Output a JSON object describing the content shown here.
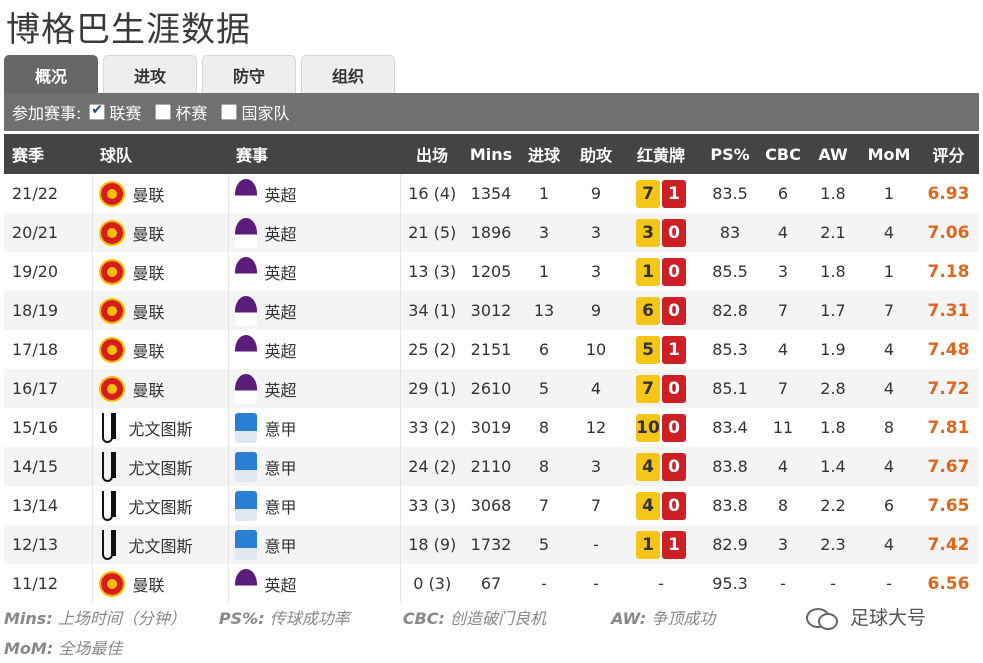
{
  "page_title": "博格巴生涯数据",
  "tabs": [
    {
      "label": "概况",
      "active": true
    },
    {
      "label": "进攻",
      "active": false
    },
    {
      "label": "防守",
      "active": false
    },
    {
      "label": "组织",
      "active": false
    }
  ],
  "filter": {
    "label": "参加赛事:",
    "options": [
      {
        "label": "联赛",
        "checked": true
      },
      {
        "label": "杯赛",
        "checked": false
      },
      {
        "label": "国家队",
        "checked": false
      }
    ]
  },
  "table": {
    "headers": [
      "赛季",
      "球队",
      "赛事",
      "出场",
      "Mins",
      "进球",
      "助攻",
      "红黄牌",
      "PS%",
      "CBC",
      "AW",
      "MoM",
      "评分"
    ],
    "rows": [
      {
        "season": "21/22",
        "team": "曼联",
        "team_icon": "man-utd-crest-icon",
        "comp": "英超",
        "comp_icon": "premier-league-icon",
        "apps": "16 (4)",
        "mins": "1354",
        "goals": "1",
        "assists": "9",
        "yellow": "7",
        "red": "1",
        "ps": "83.5",
        "cbc": "6",
        "aw": "1.8",
        "mom": "1",
        "rating": "6.93"
      },
      {
        "season": "20/21",
        "team": "曼联",
        "team_icon": "man-utd-crest-icon",
        "comp": "英超",
        "comp_icon": "premier-league-icon",
        "apps": "21 (5)",
        "mins": "1896",
        "goals": "3",
        "assists": "3",
        "yellow": "3",
        "red": "0",
        "ps": "83",
        "cbc": "4",
        "aw": "2.1",
        "mom": "4",
        "rating": "7.06"
      },
      {
        "season": "19/20",
        "team": "曼联",
        "team_icon": "man-utd-crest-icon",
        "comp": "英超",
        "comp_icon": "premier-league-icon",
        "apps": "13 (3)",
        "mins": "1205",
        "goals": "1",
        "assists": "3",
        "yellow": "1",
        "red": "0",
        "ps": "85.5",
        "cbc": "3",
        "aw": "1.8",
        "mom": "1",
        "rating": "7.18"
      },
      {
        "season": "18/19",
        "team": "曼联",
        "team_icon": "man-utd-crest-icon",
        "comp": "英超",
        "comp_icon": "premier-league-icon",
        "apps": "34 (1)",
        "mins": "3012",
        "goals": "13",
        "assists": "9",
        "yellow": "6",
        "red": "0",
        "ps": "82.8",
        "cbc": "7",
        "aw": "1.7",
        "mom": "7",
        "rating": "7.31"
      },
      {
        "season": "17/18",
        "team": "曼联",
        "team_icon": "man-utd-crest-icon",
        "comp": "英超",
        "comp_icon": "premier-league-icon",
        "apps": "25 (2)",
        "mins": "2151",
        "goals": "6",
        "assists": "10",
        "yellow": "5",
        "red": "1",
        "ps": "85.3",
        "cbc": "4",
        "aw": "1.9",
        "mom": "4",
        "rating": "7.48"
      },
      {
        "season": "16/17",
        "team": "曼联",
        "team_icon": "man-utd-crest-icon",
        "comp": "英超",
        "comp_icon": "premier-league-icon",
        "apps": "29 (1)",
        "mins": "2610",
        "goals": "5",
        "assists": "4",
        "yellow": "7",
        "red": "0",
        "ps": "85.1",
        "cbc": "7",
        "aw": "2.8",
        "mom": "4",
        "rating": "7.72"
      },
      {
        "season": "15/16",
        "team": "尤文图斯",
        "team_icon": "juventus-crest-icon",
        "comp": "意甲",
        "comp_icon": "serie-a-icon",
        "apps": "33 (2)",
        "mins": "3019",
        "goals": "8",
        "assists": "12",
        "yellow": "10",
        "red": "0",
        "ps": "83.4",
        "cbc": "11",
        "aw": "1.8",
        "mom": "8",
        "rating": "7.81"
      },
      {
        "season": "14/15",
        "team": "尤文图斯",
        "team_icon": "juventus-crest-icon",
        "comp": "意甲",
        "comp_icon": "serie-a-icon",
        "apps": "24 (2)",
        "mins": "2110",
        "goals": "8",
        "assists": "3",
        "yellow": "4",
        "red": "0",
        "ps": "83.8",
        "cbc": "4",
        "aw": "1.4",
        "mom": "4",
        "rating": "7.67"
      },
      {
        "season": "13/14",
        "team": "尤文图斯",
        "team_icon": "juventus-crest-icon",
        "comp": "意甲",
        "comp_icon": "serie-a-icon",
        "apps": "33 (3)",
        "mins": "3068",
        "goals": "7",
        "assists": "7",
        "yellow": "4",
        "red": "0",
        "ps": "83.8",
        "cbc": "8",
        "aw": "2.2",
        "mom": "6",
        "rating": "7.65"
      },
      {
        "season": "12/13",
        "team": "尤文图斯",
        "team_icon": "juventus-crest-icon",
        "comp": "意甲",
        "comp_icon": "serie-a-icon",
        "apps": "18 (9)",
        "mins": "1732",
        "goals": "5",
        "assists": "-",
        "yellow": "1",
        "red": "1",
        "ps": "82.9",
        "cbc": "3",
        "aw": "2.3",
        "mom": "4",
        "rating": "7.42"
      },
      {
        "season": "11/12",
        "team": "曼联",
        "team_icon": "man-utd-crest-icon",
        "comp": "英超",
        "comp_icon": "premier-league-icon",
        "apps": "0 (3)",
        "mins": "67",
        "goals": "-",
        "assists": "-",
        "yellow": "",
        "red": "",
        "cards_placeholder": "-",
        "ps": "95.3",
        "cbc": "-",
        "aw": "-",
        "mom": "-",
        "rating": "6.56"
      }
    ]
  },
  "legend": [
    {
      "key": "Mins:",
      "desc": "上场时间（分钟）"
    },
    {
      "key": "PS%:",
      "desc": "传球成功率"
    },
    {
      "key": "CBC:",
      "desc": "创造破门良机"
    },
    {
      "key": "AW:",
      "desc": "争顶成功"
    },
    {
      "key": "MoM:",
      "desc": "全场最佳"
    }
  ],
  "watermark": "足球大号",
  "colors": {
    "rating": "#e0661b",
    "yellow_card": "#f5c518",
    "red_card": "#cc1f26",
    "header_bg": "#444444",
    "filter_bg": "#707070"
  }
}
